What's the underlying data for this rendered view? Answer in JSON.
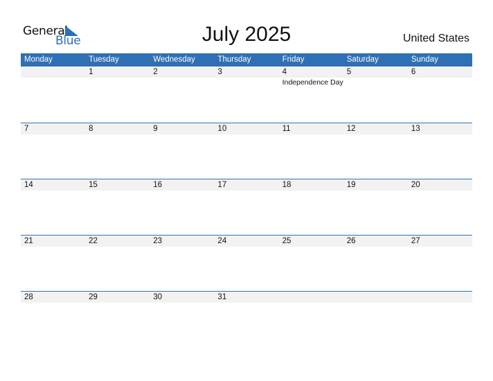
{
  "logo": {
    "word1": "General",
    "word2": "Blue",
    "icon": "triangle-flag-icon",
    "accent_color": "#2a6fba"
  },
  "title": "July 2025",
  "country": "United States",
  "colors": {
    "header_bg": "#2e70b3",
    "header_text": "#ffffff",
    "date_strip_bg": "#f2f2f2",
    "week_border": "#2e70b3"
  },
  "weekdays": [
    "Monday",
    "Tuesday",
    "Wednesday",
    "Thursday",
    "Friday",
    "Saturday",
    "Sunday"
  ],
  "weeks": [
    [
      {
        "day": "",
        "holiday": ""
      },
      {
        "day": "1",
        "holiday": ""
      },
      {
        "day": "2",
        "holiday": ""
      },
      {
        "day": "3",
        "holiday": ""
      },
      {
        "day": "4",
        "holiday": "Independence Day"
      },
      {
        "day": "5",
        "holiday": ""
      },
      {
        "day": "6",
        "holiday": ""
      }
    ],
    [
      {
        "day": "7",
        "holiday": ""
      },
      {
        "day": "8",
        "holiday": ""
      },
      {
        "day": "9",
        "holiday": ""
      },
      {
        "day": "10",
        "holiday": ""
      },
      {
        "day": "11",
        "holiday": ""
      },
      {
        "day": "12",
        "holiday": ""
      },
      {
        "day": "13",
        "holiday": ""
      }
    ],
    [
      {
        "day": "14",
        "holiday": ""
      },
      {
        "day": "15",
        "holiday": ""
      },
      {
        "day": "16",
        "holiday": ""
      },
      {
        "day": "17",
        "holiday": ""
      },
      {
        "day": "18",
        "holiday": ""
      },
      {
        "day": "19",
        "holiday": ""
      },
      {
        "day": "20",
        "holiday": ""
      }
    ],
    [
      {
        "day": "21",
        "holiday": ""
      },
      {
        "day": "22",
        "holiday": ""
      },
      {
        "day": "23",
        "holiday": ""
      },
      {
        "day": "24",
        "holiday": ""
      },
      {
        "day": "25",
        "holiday": ""
      },
      {
        "day": "26",
        "holiday": ""
      },
      {
        "day": "27",
        "holiday": ""
      }
    ],
    [
      {
        "day": "28",
        "holiday": ""
      },
      {
        "day": "29",
        "holiday": ""
      },
      {
        "day": "30",
        "holiday": ""
      },
      {
        "day": "31",
        "holiday": ""
      },
      {
        "day": "",
        "holiday": ""
      },
      {
        "day": "",
        "holiday": ""
      },
      {
        "day": "",
        "holiday": ""
      }
    ]
  ]
}
